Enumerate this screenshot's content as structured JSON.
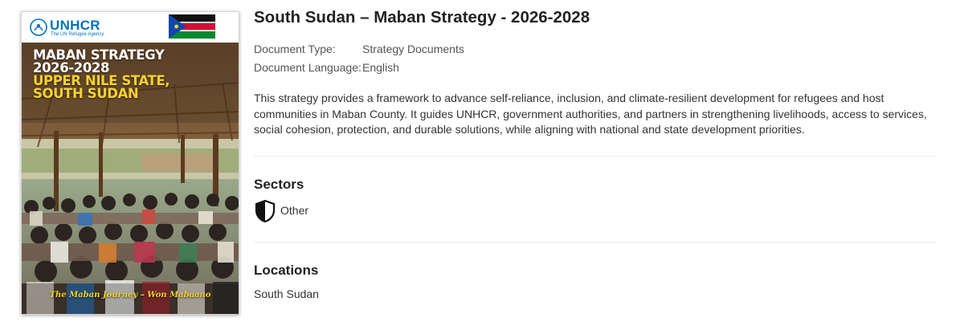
{
  "cover": {
    "org_name": "UNHCR",
    "org_tagline": "The UN Refugee Agency",
    "title_line1": "MABAN STRATEGY",
    "title_line2": "2026-2028",
    "title_line3": "UPPER NILE STATE,",
    "title_line4": "SOUTH SUDAN",
    "tagline": "The Maban Journey – Won Mabaano",
    "brand_color": "#0072bc",
    "highlight_color": "#f5d22e"
  },
  "document": {
    "title": "South Sudan – Maban Strategy - 2026-2028",
    "type_label": "Document Type:",
    "type_value": "Strategy Documents",
    "language_label": "Document Language:",
    "language_value": "English",
    "description": "This strategy provides a framework to advance self-reliance, inclusion, and climate-resilient development for refugees and host communities in Maban County. It guides UNHCR, government authorities, and partners in strengthening livelihoods, access to services, social cohesion, protection, and durable solutions, while aligning with national and state development priorities."
  },
  "sectors": {
    "heading": "Sectors",
    "items": [
      {
        "label": "Other",
        "icon": "shield-icon"
      }
    ]
  },
  "locations": {
    "heading": "Locations",
    "items": [
      "South Sudan"
    ]
  }
}
